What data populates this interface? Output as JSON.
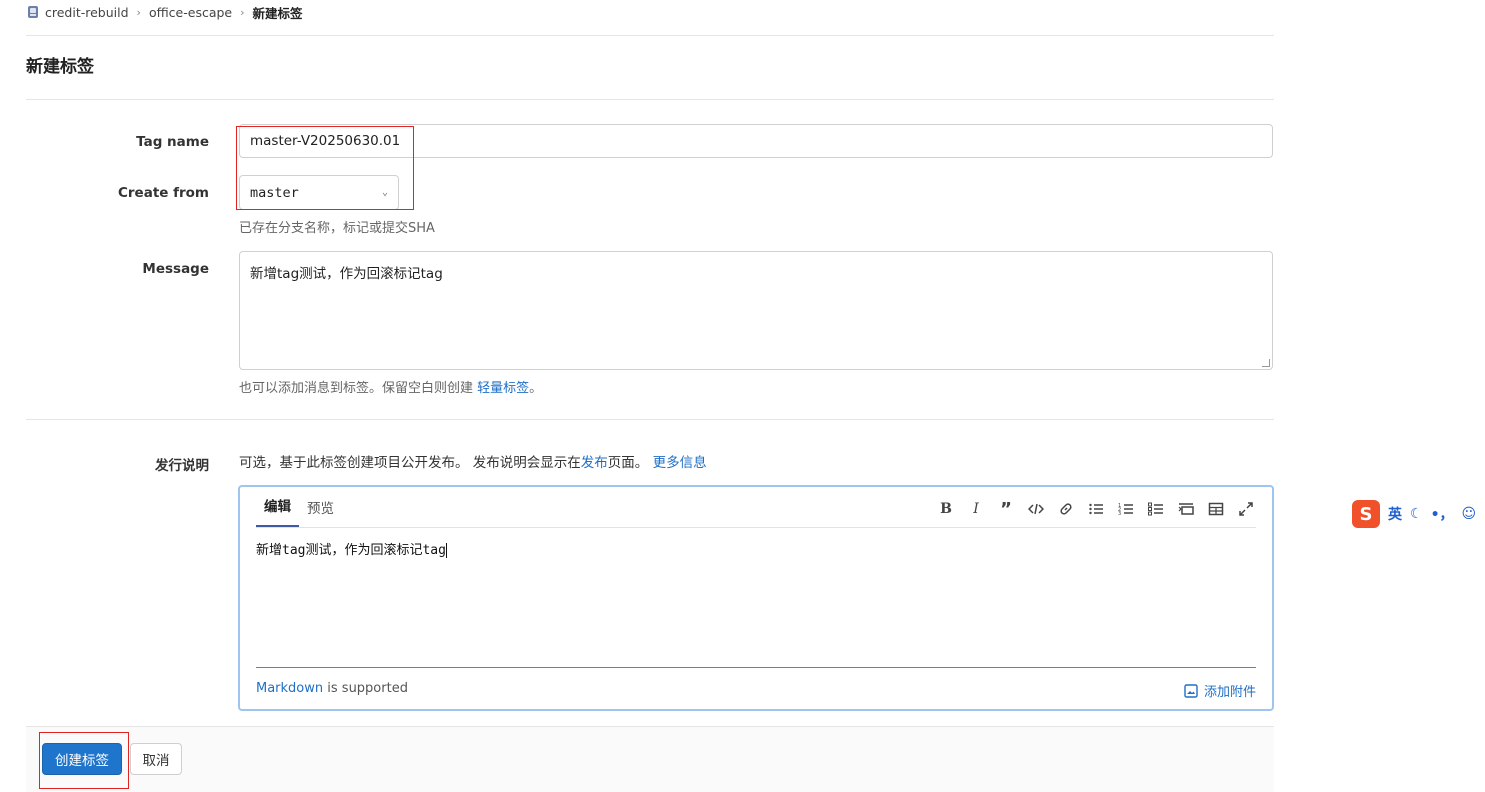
{
  "breadcrumb": {
    "items": [
      "credit-rebuild",
      "office-escape"
    ],
    "current": "新建标签"
  },
  "page": {
    "title": "新建标签"
  },
  "form": {
    "tag_name": {
      "label": "Tag name",
      "value": "master-V20250630.01"
    },
    "create_from": {
      "label": "Create from",
      "value": "master",
      "help": "已存在分支名称，标记或提交SHA"
    },
    "message": {
      "label": "Message",
      "value": "新增tag测试，作为回滚标记tag",
      "help_prefix": "也可以添加消息到标签。保留空白则创建 ",
      "help_link": "轻量标签",
      "help_suffix": "。"
    },
    "release_notes": {
      "label": "发行说明",
      "desc_prefix": "可选，基于此标签创建项目公开发布。 发布说明会显示在",
      "desc_link": "发布",
      "desc_suffix": "页面。 ",
      "more_link": "更多信息",
      "tabs": [
        "编辑",
        "预览"
      ],
      "content": "新增tag测试，作为回滚标记tag",
      "markdown_link": "Markdown",
      "markdown_suffix": " is supported",
      "attach_label": "添加附件"
    }
  },
  "buttons": {
    "create": "创建标签",
    "cancel": "取消"
  },
  "ime": {
    "lang": "英",
    "punct": "•，"
  },
  "colors": {
    "primary": "#1f75cb",
    "link": "#1f6fc7",
    "highlight": "#e02424"
  }
}
